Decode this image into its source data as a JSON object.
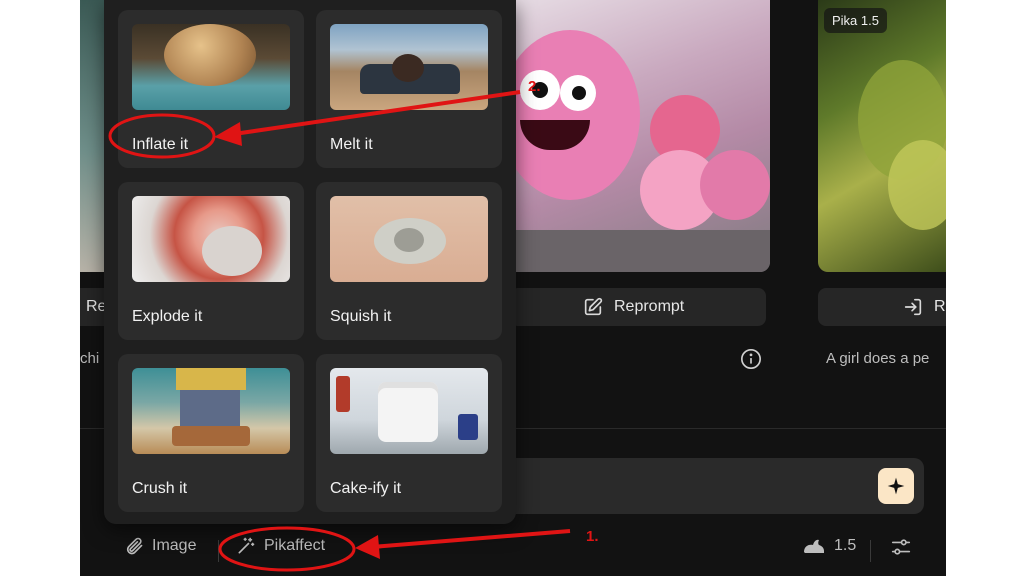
{
  "feed": {
    "version_badge": "Pika 1.5",
    "left_action_label": "Re",
    "center_action_label": "Reprompt",
    "right_action_label": "R",
    "caption_left": "chi",
    "caption_right": "A girl does a pe"
  },
  "effects_menu": {
    "items": [
      {
        "label": "Inflate it"
      },
      {
        "label": "Melt it"
      },
      {
        "label": "Explode it"
      },
      {
        "label": "Squish it"
      },
      {
        "label": "Crush it"
      },
      {
        "label": "Cake-ify it"
      }
    ]
  },
  "toolbar": {
    "image_label": "Image",
    "pikaffect_label": "Pikaffect",
    "model_version": "1.5"
  },
  "annotations": {
    "step1": "1.",
    "step2": "2."
  },
  "colors": {
    "background": "#121212",
    "card": "#2c2c2c",
    "accent_button": "#fbe6c6",
    "annotation": "#e01414"
  },
  "icons": [
    "info-icon",
    "reprompt-icon",
    "import-icon",
    "paperclip-icon",
    "magic-wand-icon",
    "rabbit-icon",
    "sliders-icon",
    "sparkle-icon"
  ]
}
